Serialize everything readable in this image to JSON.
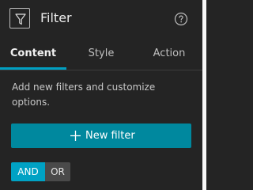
{
  "header": {
    "icon": "filter-funnel-icon",
    "title": "Filter",
    "help_icon": "question-circle-icon"
  },
  "tabs": [
    {
      "label": "Content",
      "active": true
    },
    {
      "label": "Style",
      "active": false
    },
    {
      "label": "Action",
      "active": false
    }
  ],
  "content": {
    "description": "Add new filters and customize options.",
    "new_filter_label": "New filter",
    "new_filter_icon": "plus-icon"
  },
  "logic_toggle": {
    "and_label": "AND",
    "or_label": "OR",
    "selected": "AND"
  },
  "colors": {
    "background": "#242424",
    "accent": "#00a0c2",
    "button": "#00889e",
    "toggle_active": "#00a2c4",
    "toggle_inactive": "#4a4a4a"
  }
}
